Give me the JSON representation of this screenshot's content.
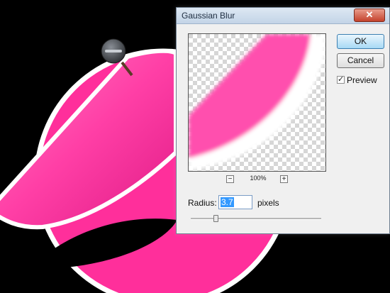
{
  "dialog": {
    "title": "Gaussian Blur",
    "ok_label": "OK",
    "cancel_label": "Cancel",
    "preview_label": "Preview",
    "preview_checked": true,
    "zoom_level": "100%",
    "zoom_out_symbol": "−",
    "zoom_in_symbol": "+",
    "radius_label": "Radius:",
    "radius_value": "3.7",
    "units_label": "pixels",
    "close_symbol": "✕",
    "slider_level": 0.19
  },
  "icons": {
    "close": "close-icon",
    "checkbox": "checkmark-icon",
    "tool": "pin-tool-icon"
  },
  "colors": {
    "shape_pink": "#ff3fa6",
    "shape_outline": "#ffffff",
    "canvas_background": "#000000",
    "ok_accent": "#3c7fb1",
    "selection": "#3399ff"
  }
}
